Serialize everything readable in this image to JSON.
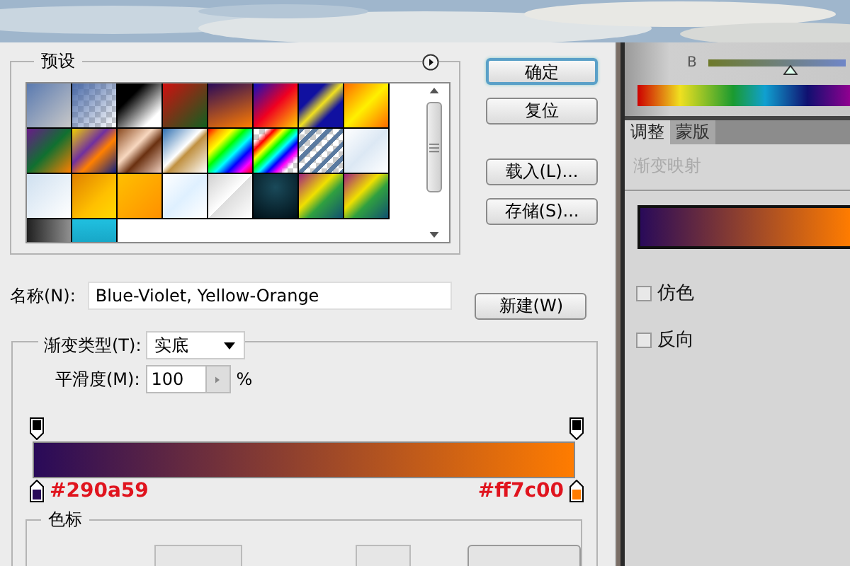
{
  "presets": {
    "title": "预设"
  },
  "buttons": [
    {
      "label": "确定",
      "default": true
    },
    {
      "label": "复位",
      "default": false
    },
    {
      "label": "载入(L)...",
      "default": false
    },
    {
      "label": "存储(S)...",
      "default": false
    }
  ],
  "name_field": {
    "label": "名称(N):",
    "value": "Blue-Violet, Yellow-Orange",
    "button": "新建(W)"
  },
  "gradient_type": {
    "label": "渐变类型(T):",
    "value": "实底"
  },
  "smoothness": {
    "label": "平滑度(M):",
    "value": "100",
    "unit": "%"
  },
  "opacity_stops": [
    {
      "color": "#000000"
    },
    {
      "color": "#000000"
    }
  ],
  "color_stops": [
    {
      "color": "#290a59",
      "label": "#290a59"
    },
    {
      "color": "#ff7c00",
      "label": "#ff7c00"
    }
  ],
  "stops_section": {
    "title": "色标"
  },
  "channel_slider": {
    "label": "B",
    "level": 0.6
  },
  "tabs": [
    {
      "label": "调整",
      "selected": true
    },
    {
      "label": "蒙版",
      "selected": false
    }
  ],
  "adjustment": {
    "title": "渐变映射",
    "options": [
      {
        "label": "仿色",
        "checked": false
      },
      {
        "label": "反向",
        "checked": false
      }
    ]
  }
}
